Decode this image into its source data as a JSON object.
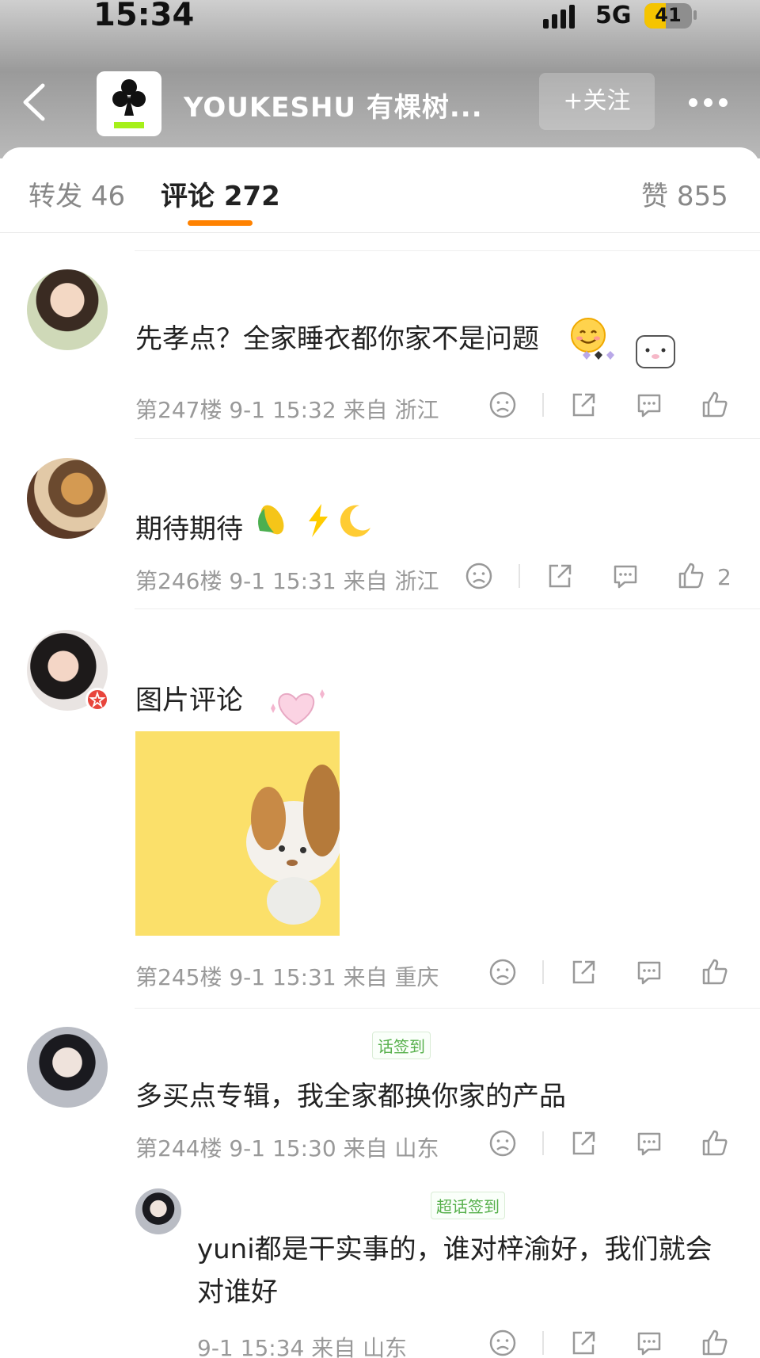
{
  "status_bar": {
    "time": "15:34",
    "network": "5G",
    "battery": "41"
  },
  "header": {
    "brand": "YOUKESHU 有棵树...",
    "follow_label": "+关注"
  },
  "tabs": [
    {
      "label": "转发",
      "count": "46"
    },
    {
      "label": "评论",
      "count": "272"
    },
    {
      "label": "赞",
      "count": "855"
    }
  ],
  "comments": [
    {
      "text": "先孝点？全家睡衣都你家不是问题",
      "floor": "第247楼",
      "time": "9-1 15:32",
      "from": "来自 浙江",
      "likes": ""
    },
    {
      "text": "期待期待",
      "floor": "第246楼",
      "time": "9-1 15:31",
      "from": "来自 浙江",
      "likes": "2"
    },
    {
      "text": "图片评论",
      "floor": "第245楼",
      "time": "9-1 15:31",
      "from": "来自 重庆",
      "likes": ""
    },
    {
      "text": "多买点专辑，我全家都换你家的产品",
      "floor": "第244楼",
      "time": "9-1 15:30",
      "from": "来自 山东",
      "likes": "",
      "tag": "话签到"
    }
  ],
  "reply": {
    "text": "yuni都是干实事的，谁对梓渝好，我们就会对谁好",
    "time": "9-1 15:34",
    "from": "来自 山东",
    "tag": "超话签到"
  }
}
